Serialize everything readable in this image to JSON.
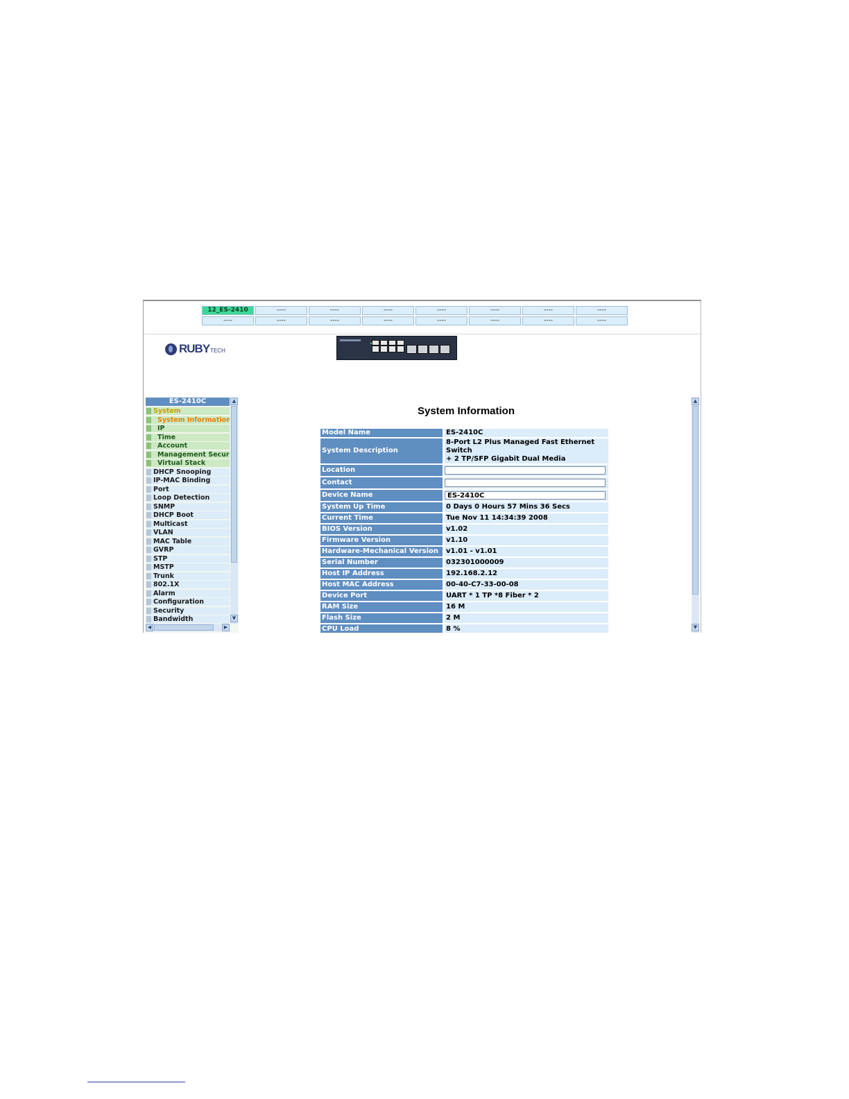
{
  "stack": {
    "row1": [
      "12_ES-2410",
      "----",
      "----",
      "----",
      "----",
      "----",
      "----",
      "----"
    ],
    "row2": [
      "----",
      "----",
      "----",
      "----",
      "----",
      "----",
      "----",
      "----"
    ]
  },
  "logo": {
    "main": "RUBY",
    "sub": "TECH"
  },
  "sidebar": {
    "header": "ES-2410C",
    "items": [
      {
        "label": "System"
      },
      {
        "label": "System Information"
      },
      {
        "label": "IP"
      },
      {
        "label": "Time"
      },
      {
        "label": "Account"
      },
      {
        "label": "Management Security"
      },
      {
        "label": "Virtual Stack"
      },
      {
        "label": "DHCP Snooping"
      },
      {
        "label": "IP-MAC Binding"
      },
      {
        "label": "Port"
      },
      {
        "label": "Loop Detection"
      },
      {
        "label": "SNMP"
      },
      {
        "label": "DHCP Boot"
      },
      {
        "label": "Multicast"
      },
      {
        "label": "VLAN"
      },
      {
        "label": "MAC Table"
      },
      {
        "label": "GVRP"
      },
      {
        "label": "STP"
      },
      {
        "label": "MSTP"
      },
      {
        "label": "Trunk"
      },
      {
        "label": "802.1X"
      },
      {
        "label": "Alarm"
      },
      {
        "label": "Configuration"
      },
      {
        "label": "Security"
      },
      {
        "label": "Bandwidth"
      }
    ]
  },
  "main": {
    "title": "System Information",
    "rows": [
      {
        "label": "Model Name",
        "value": "ES-2410C"
      },
      {
        "label": "System Description",
        "value": "8-Port L2 Plus Managed Fast Ethernet Switch",
        "value2": "+ 2 TP/SFP Gigabit Dual Media"
      },
      {
        "label": "Location",
        "value": ""
      },
      {
        "label": "Contact",
        "value": ""
      },
      {
        "label": "Device Name",
        "value": "ES-2410C"
      },
      {
        "label": "System Up Time",
        "value": "0 Days 0 Hours 57 Mins 36 Secs"
      },
      {
        "label": "Current Time",
        "value": "Tue Nov 11 14:34:39 2008"
      },
      {
        "label": "BIOS Version",
        "value": "v1.02"
      },
      {
        "label": "Firmware Version",
        "value": "v1.10"
      },
      {
        "label": "Hardware-Mechanical Version",
        "value": "v1.01 - v1.01"
      },
      {
        "label": "Serial Number",
        "value": "032301000009"
      },
      {
        "label": "Host IP Address",
        "value": "192.168.2.12"
      },
      {
        "label": "Host MAC Address",
        "value": "00-40-C7-33-00-08"
      },
      {
        "label": "Device Port",
        "value": "UART * 1 TP *8 Fiber * 2"
      },
      {
        "label": "RAM Size",
        "value": "16 M"
      },
      {
        "label": "Flash Size",
        "value": "2 M"
      },
      {
        "label": "CPU Load",
        "value": "8 %"
      }
    ]
  }
}
